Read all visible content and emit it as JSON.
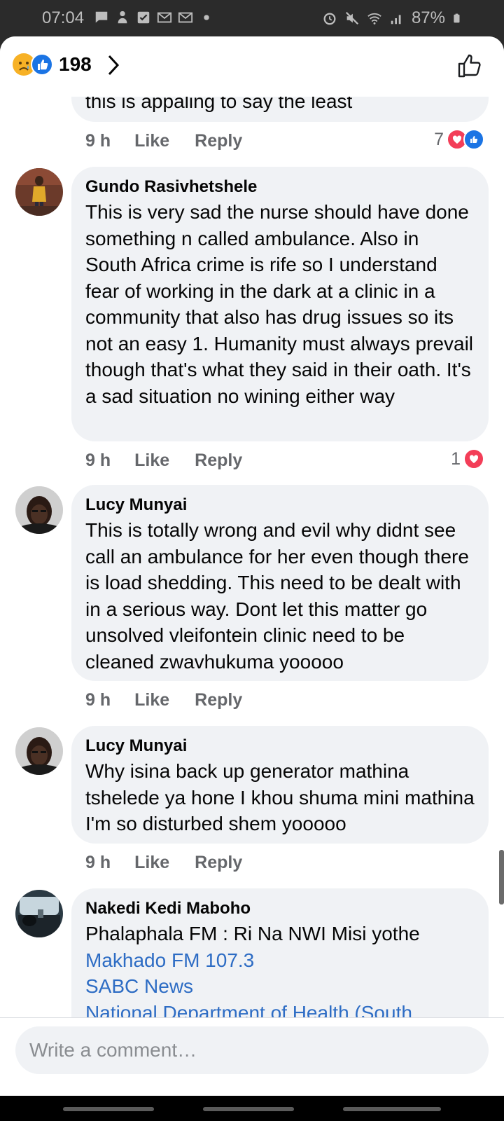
{
  "status_bar": {
    "time": "07:04",
    "battery": "87%",
    "left_icons": [
      "chat-bubble-icon",
      "alarm-person-icon",
      "checkbox-icon",
      "gmail-icon",
      "gmail-icon",
      "dot-icon"
    ],
    "right_icons": [
      "alarm-icon",
      "mute-icon",
      "wifi-icon",
      "signal-icon",
      "battery-icon"
    ]
  },
  "header": {
    "reaction_icons": [
      "sad-icon",
      "like-icon"
    ],
    "reaction_count": "198"
  },
  "comments": [
    {
      "text": "this is appaling to say the least",
      "time": "9 h",
      "like_label": "Like",
      "reply_label": "Reply",
      "reaction_count": "7",
      "reactions": [
        "love",
        "like"
      ]
    },
    {
      "author": "Gundo Rasivhetshele",
      "text": "This is very sad the nurse should have done something n called ambulance. Also in South Africa crime is rife so I understand fear of working in the dark at a clinic in a community that also has drug issues so its not an easy 1. Humanity must always prevail though that's what they said in their oath. It's a sad situation no wining either way",
      "time": "9 h",
      "like_label": "Like",
      "reply_label": "Reply",
      "reaction_count": "1",
      "reactions": [
        "love"
      ]
    },
    {
      "author": "Lucy Munyai",
      "text": "This is totally wrong and evil why didnt see call an ambulance for her even though there is load shedding. This need to be dealt with in a serious way. Dont let this matter go unsolved vleifontein clinic need to be cleaned zwavhukuma yooooo",
      "time": "9 h",
      "like_label": "Like",
      "reply_label": "Reply"
    },
    {
      "author": "Lucy Munyai",
      "text": "Why isina back up generator mathina tshelede ya hone I khou shuma mini mathina I'm so disturbed shem yooooo",
      "time": "9 h",
      "like_label": "Like",
      "reply_label": "Reply"
    },
    {
      "author": "Nakedi Kedi Maboho",
      "text": "Phalaphala FM : Ri Na NWI Misi yothe",
      "links": [
        "Makhado FM 107.3",
        "SABC News",
        "National Department of Health (South"
      ]
    }
  ],
  "composer": {
    "placeholder": "Write a comment…"
  },
  "colors": {
    "bubble": "#f0f2f5",
    "link": "#2d6cc4",
    "meta": "#65676b",
    "love": "#f33e58",
    "like": "#1b74e4",
    "sad": "#f7b125"
  }
}
